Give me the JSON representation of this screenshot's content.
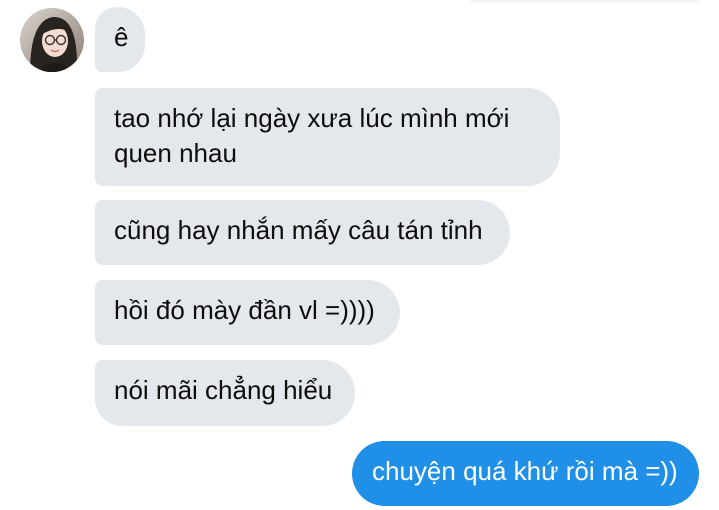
{
  "conversation": {
    "contact_avatar_icon": "profile-photo-icon",
    "messages": [
      {
        "direction": "incoming",
        "text": "ê"
      },
      {
        "direction": "incoming",
        "text": "tao nhớ lại ngày xưa lúc mình mới quen nhau"
      },
      {
        "direction": "incoming",
        "text": "cũng hay nhắn mấy câu tán tỉnh"
      },
      {
        "direction": "incoming",
        "text": "hồi đó mày đần vl =))))"
      },
      {
        "direction": "incoming",
        "text": "nói mãi chẳng hiểu"
      },
      {
        "direction": "outgoing",
        "text": "chuyện quá khứ rồi mà =))"
      }
    ],
    "colors": {
      "incoming_bubble": "#e4e7eb",
      "outgoing_bubble": "#1f8fe8",
      "incoming_text": "#0d0d0d",
      "outgoing_text": "#ffffff"
    }
  }
}
